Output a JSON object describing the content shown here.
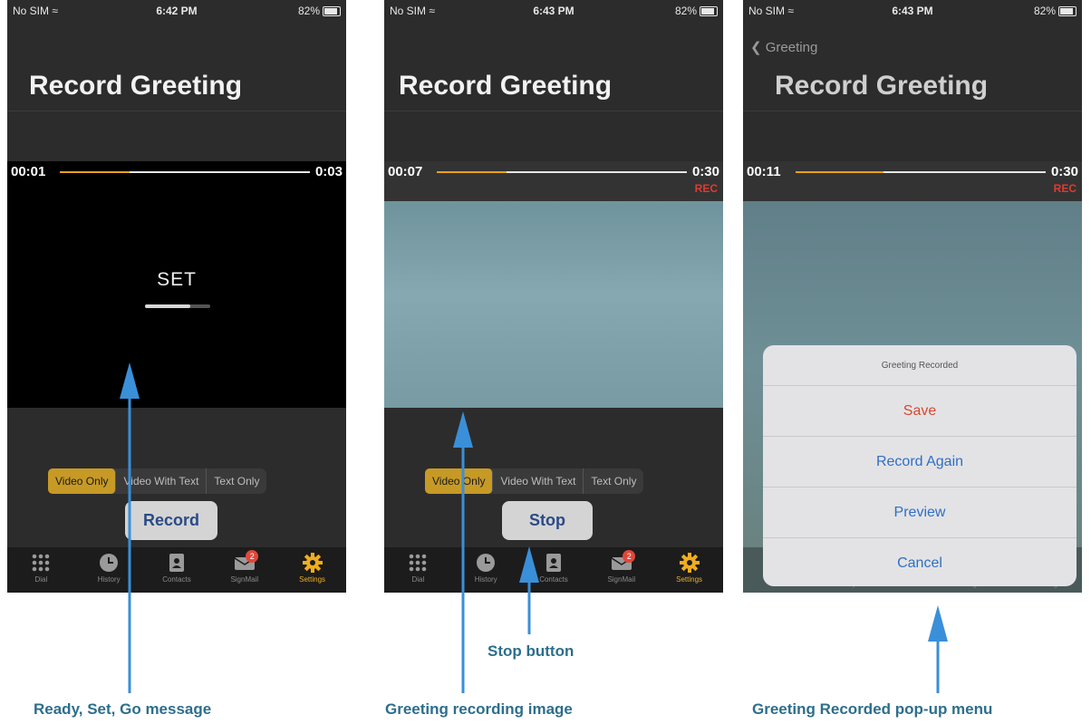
{
  "status": {
    "carrier": "No SIM",
    "battery": "82%",
    "times": [
      "6:42 PM",
      "6:43 PM",
      "6:43 PM"
    ]
  },
  "screen_title": "Record Greeting",
  "back_label": "Greeting",
  "panel1": {
    "current_time": "00:01",
    "total_time": "0:03",
    "progress": 0.28,
    "message": "SET",
    "set_progress": 0.7,
    "button_label": "Record"
  },
  "panel2": {
    "current_time": "00:07",
    "total_time": "0:30",
    "progress": 0.28,
    "rec_label": "REC",
    "button_label": "Stop"
  },
  "panel3": {
    "current_time": "00:11",
    "total_time": "0:30",
    "progress": 0.35,
    "rec_label": "REC",
    "sheet": {
      "title": "Greeting Recorded",
      "items": [
        "Save",
        "Record Again",
        "Preview",
        "Cancel"
      ]
    }
  },
  "mode_options": [
    "Video Only",
    "Video With Text",
    "Text Only"
  ],
  "tabs": [
    "Dial",
    "History",
    "Contacts",
    "SignMail",
    "Settings"
  ],
  "signmail_badge": "2",
  "callouts": {
    "ready_set_go": "Ready, Set, Go message",
    "stop_button": "Stop button",
    "recording_image": "Greeting recording image",
    "popup_menu": "Greeting Recorded pop-up menu"
  },
  "colors": {
    "accent": "#e8a31b",
    "rec": "#e23a2e",
    "callout": "#2d6e8c",
    "arrow": "#3a8fd9"
  }
}
